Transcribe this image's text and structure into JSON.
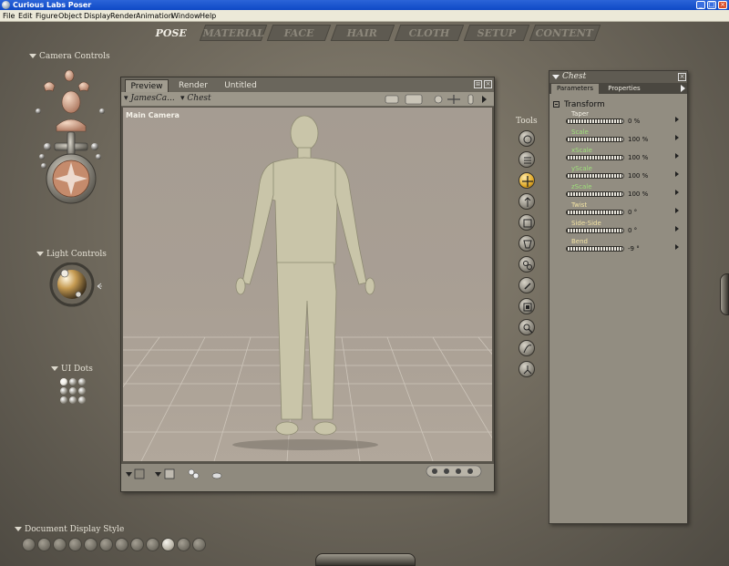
{
  "window": {
    "title": "Curious Labs Poser"
  },
  "menu": [
    "File",
    "Edit",
    "Figure",
    "Object",
    "Display",
    "Render",
    "Animation",
    "Window",
    "Help"
  ],
  "rooms": [
    "POSE",
    "MATERIAL",
    "FACE",
    "HAIR",
    "CLOTH",
    "SETUP",
    "CONTENT"
  ],
  "camera_controls": {
    "label": "Camera Controls"
  },
  "light_controls": {
    "label": "Light Controls"
  },
  "ui_dots": {
    "label": "UI Dots"
  },
  "document_display_style": {
    "label": "Document Display Style"
  },
  "viewport": {
    "tabs": [
      "Preview",
      "Render",
      "Untitled"
    ],
    "figure_select": "JamesCa...",
    "actor_select": "Chest",
    "camera_label": "Main Camera"
  },
  "tools": {
    "label": "Tools"
  },
  "params": {
    "title": "Chest",
    "tabs": [
      "Parameters",
      "Properties"
    ],
    "group": "Transform",
    "rows": [
      {
        "label": "Taper",
        "value": "0 %",
        "color": "#f4f1e6"
      },
      {
        "label": "Scale",
        "value": "100 %",
        "color": "#9fe07a"
      },
      {
        "label": "xScale",
        "value": "100 %",
        "color": "#9fe07a"
      },
      {
        "label": "yScale",
        "value": "100 %",
        "color": "#9fe07a"
      },
      {
        "label": "zScale",
        "value": "100 %",
        "color": "#9fe07a"
      },
      {
        "label": "Twist",
        "value": "0 °",
        "color": "#f2e3a3"
      },
      {
        "label": "Side-Side",
        "value": "0 °",
        "color": "#f2e3a3"
      },
      {
        "label": "Bend",
        "value": "-9 °",
        "color": "#f2e3a3"
      }
    ]
  }
}
